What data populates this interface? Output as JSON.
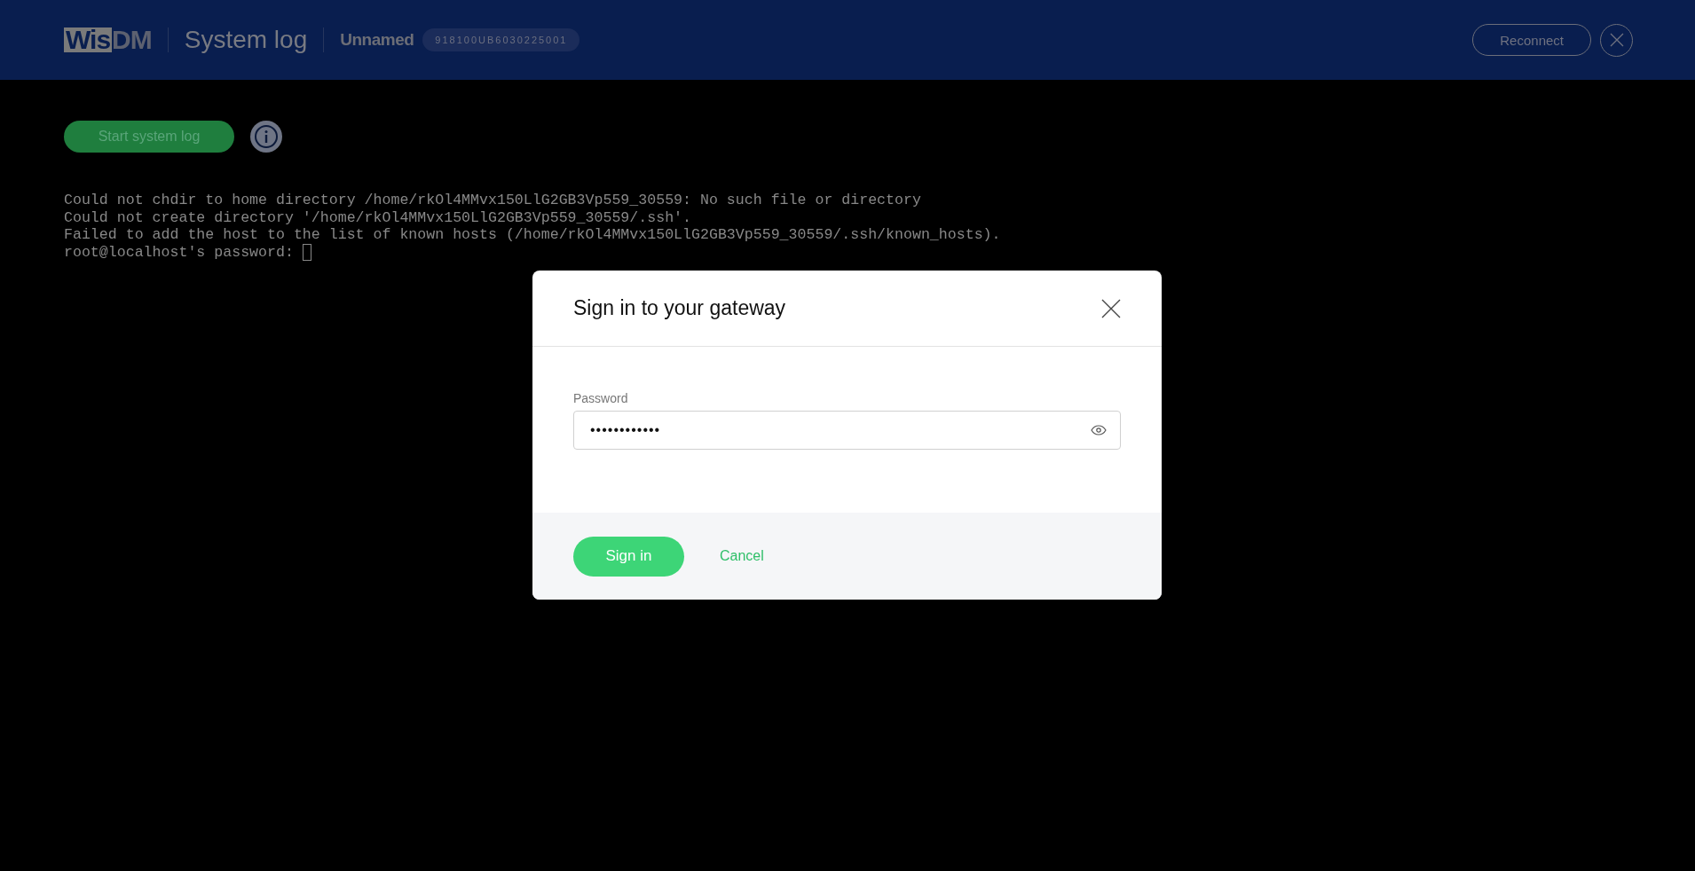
{
  "header": {
    "logo": {
      "boxed": "Wis",
      "plain": "DM"
    },
    "title": "System log",
    "device_name": "Unnamed",
    "serial": "918100UB6030225001",
    "reconnect_button": "Reconnect"
  },
  "toolbar": {
    "start_button": "Start system log"
  },
  "terminal": {
    "lines": [
      "Could not chdir to home directory /home/rkOl4MMvx150LlG2GB3Vp559_30559: No such file or directory",
      "Could not create directory '/home/rkOl4MMvx150LlG2GB3Vp559_30559/.ssh'.",
      "Failed to add the host to the list of known hosts (/home/rkOl4MMvx150LlG2GB3Vp559_30559/.ssh/known_hosts).",
      "root@localhost's password: "
    ],
    "cursor": true
  },
  "dialog": {
    "title": "Sign in to your gateway",
    "password_label": "Password",
    "password_value": "••••••••••••",
    "sign_in_button": "Sign in",
    "cancel_link": "Cancel"
  }
}
